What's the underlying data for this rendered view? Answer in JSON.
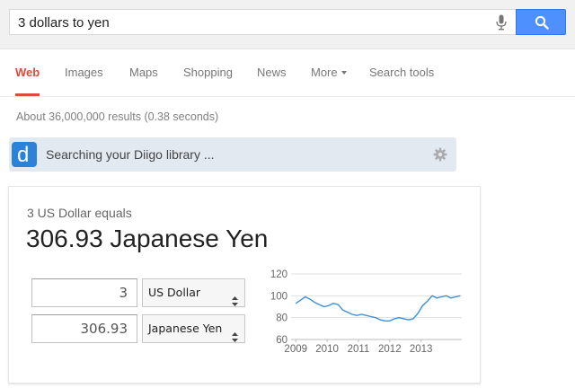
{
  "search": {
    "query": "3 dollars to yen"
  },
  "tabs": [
    {
      "label": "Web"
    },
    {
      "label": "Images"
    },
    {
      "label": "Maps"
    },
    {
      "label": "Shopping"
    },
    {
      "label": "News"
    },
    {
      "label": "More"
    },
    {
      "label": "Search tools"
    }
  ],
  "stats": "About 36,000,000 results (0.38 seconds)",
  "diigo": {
    "logo_letter": "d",
    "text": "Searching your Diigo library ..."
  },
  "converter": {
    "equals_text": "3 US Dollar equals",
    "result_text": "306.93 Japanese Yen",
    "from_amount": "3",
    "from_currency": "US Dollar",
    "to_amount": "306.93",
    "to_currency": "Japanese Yen"
  },
  "colors": {
    "accent_red": "#dd4b39",
    "search_blue": "#4d90fe",
    "chart_line": "#3b8fdc"
  },
  "chart_data": {
    "type": "line",
    "title": "",
    "xlabel": "",
    "ylabel": "",
    "x_ticks": [
      "2009",
      "2010",
      "2011",
      "2012",
      "2013"
    ],
    "y_ticks": [
      60,
      80,
      100,
      120
    ],
    "xlim": [
      2008.85,
      2014.3
    ],
    "ylim": [
      60,
      120
    ],
    "grid": true,
    "series": [
      {
        "x": [
          2009.0,
          2009.15,
          2009.3,
          2009.45,
          2009.6,
          2009.75,
          2009.9,
          2010.05,
          2010.2,
          2010.35,
          2010.5,
          2010.65,
          2010.8,
          2010.95,
          2011.1,
          2011.25,
          2011.4,
          2011.55,
          2011.7,
          2011.85,
          2012.0,
          2012.15,
          2012.3,
          2012.45,
          2012.6,
          2012.75,
          2012.9,
          2013.05,
          2013.2,
          2013.35,
          2013.5,
          2013.65,
          2013.8,
          2013.95,
          2014.1,
          2014.25
        ],
        "y": [
          93,
          96,
          99,
          97,
          94,
          92,
          90,
          91,
          93,
          92,
          87,
          85,
          83,
          82,
          83,
          82,
          81,
          80,
          78,
          77,
          77,
          79,
          80,
          79,
          78,
          79,
          84,
          91,
          95,
          100,
          98,
          99,
          100,
          98,
          99,
          100
        ]
      }
    ]
  }
}
